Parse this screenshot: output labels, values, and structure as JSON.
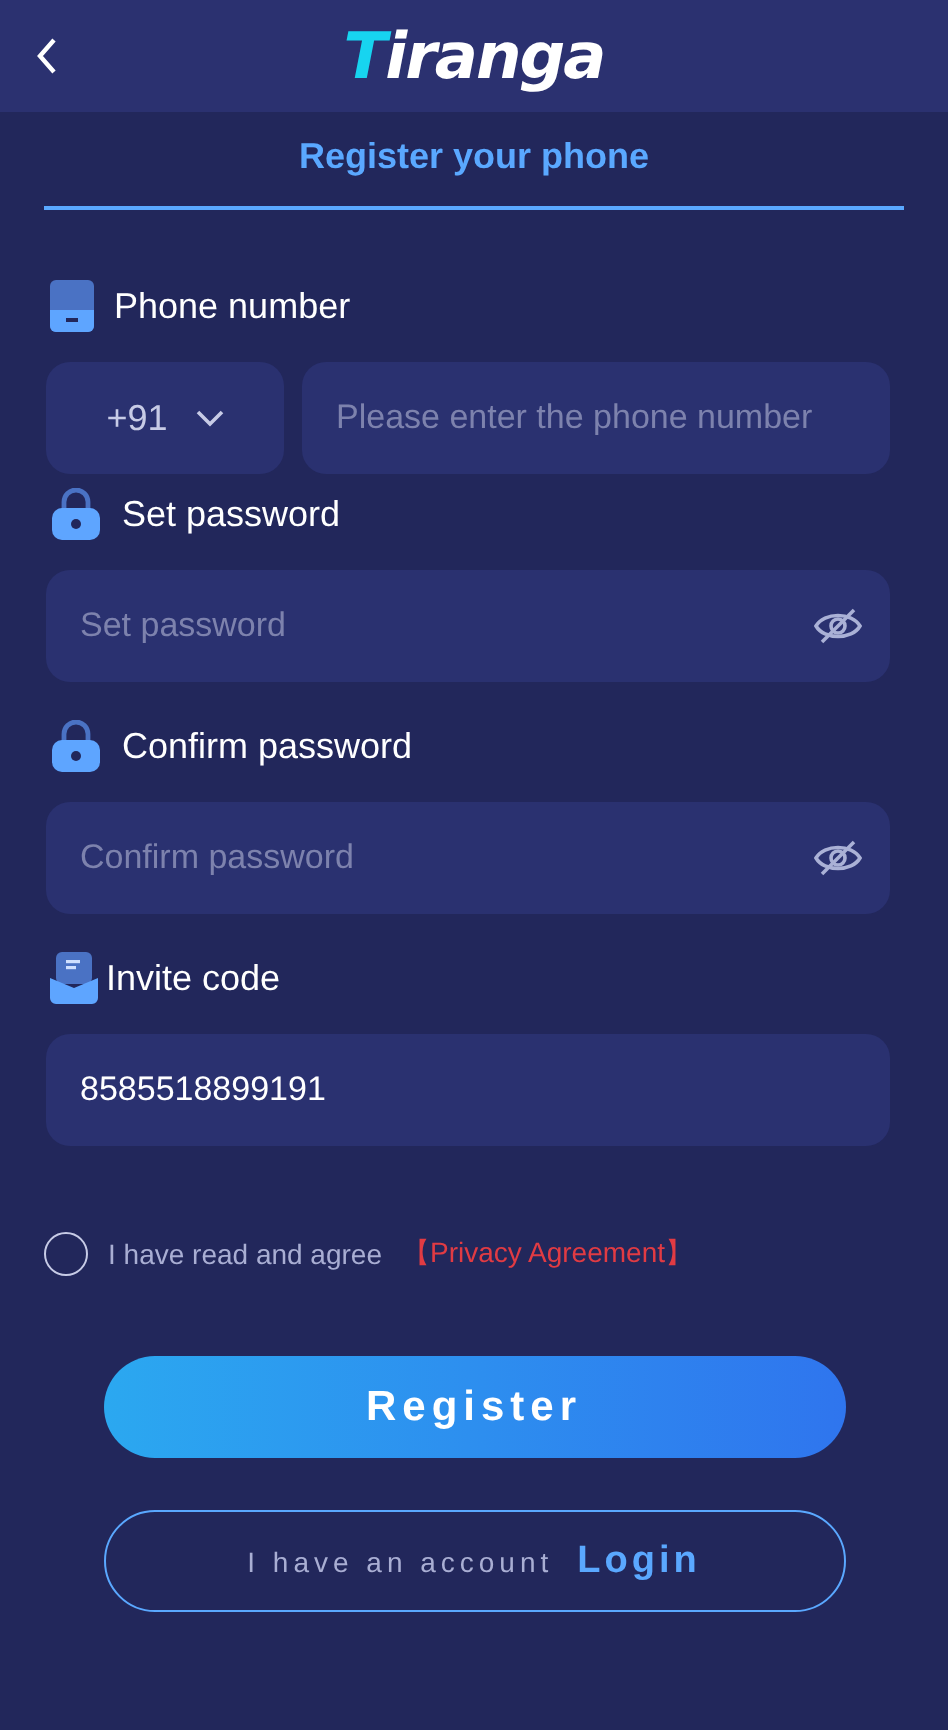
{
  "header": {
    "logo": "Tiranga"
  },
  "tabs": [
    {
      "label": "Register your phone",
      "selected": true
    }
  ],
  "fields": [
    {
      "kind": "phone",
      "label": "Phone number",
      "country_code": "+91",
      "placeholder": "Please enter the phone number"
    },
    {
      "kind": "password",
      "label": "Set password",
      "placeholder": "Set password"
    },
    {
      "kind": "password",
      "label": "Confirm password",
      "placeholder": "Confirm password"
    },
    {
      "kind": "text",
      "label": "Invite code",
      "value": "8585518899191"
    }
  ],
  "agreement": {
    "checked": false,
    "text": "I have read and agree",
    "link": "【Privacy Agreement】"
  },
  "register_button": "Register",
  "login": {
    "text": "I have an account",
    "link": "Login"
  }
}
